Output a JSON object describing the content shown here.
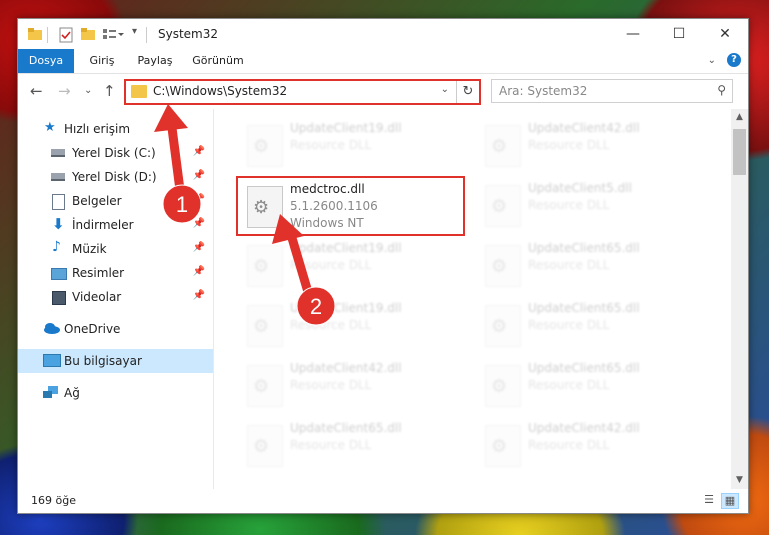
{
  "window": {
    "title": "System32"
  },
  "ribbon": {
    "tabs": [
      "Dosya",
      "Giriş",
      "Paylaş",
      "Görünüm"
    ]
  },
  "address": {
    "path": "C:\\Windows\\System32"
  },
  "search": {
    "placeholder": "Ara: System32"
  },
  "nav": {
    "items": [
      {
        "label": "Hızlı erişim",
        "icon": "star-icon",
        "pinned": false
      },
      {
        "label": "Yerel Disk (C:)",
        "icon": "drive-icon",
        "pinned": true
      },
      {
        "label": "Yerel Disk (D:)",
        "icon": "drive-icon",
        "pinned": true
      },
      {
        "label": "Belgeler",
        "icon": "document-icon",
        "pinned": true
      },
      {
        "label": "İndirmeler",
        "icon": "download-icon",
        "pinned": true
      },
      {
        "label": "Müzik",
        "icon": "music-icon",
        "pinned": true
      },
      {
        "label": "Resimler",
        "icon": "pictures-icon",
        "pinned": true
      },
      {
        "label": "Videolar",
        "icon": "video-icon",
        "pinned": true
      },
      {
        "label": "OneDrive",
        "icon": "cloud-icon",
        "pinned": false
      },
      {
        "label": "Bu bilgisayar",
        "icon": "computer-icon",
        "pinned": false,
        "selected": true
      },
      {
        "label": "Ağ",
        "icon": "network-icon",
        "pinned": false
      }
    ]
  },
  "files": {
    "highlighted": {
      "name": "medctroc.dll",
      "version": "5.1.2600.1106",
      "company": "Windows NT"
    },
    "col1": [
      {
        "name": "UpdateClient19.dll",
        "desc": "Resource DLL"
      },
      {
        "name": "UpdateClient19.dll",
        "desc": "Resource DLL"
      },
      {
        "name": "UpdateClient19.dll",
        "desc": "Resource DLL"
      },
      {
        "name": "UpdateClient42.dll",
        "desc": "Resource DLL"
      },
      {
        "name": "UpdateClient65.dll",
        "desc": "Resource DLL"
      }
    ],
    "col2": [
      {
        "name": "UpdateClient42.dll",
        "desc": "Resource DLL"
      },
      {
        "name": "UpdateClient5.dll",
        "desc": "Resource DLL"
      },
      {
        "name": "UpdateClient65.dll",
        "desc": "Resource DLL"
      },
      {
        "name": "UpdateClient65.dll",
        "desc": "Resource DLL"
      },
      {
        "name": "UpdateClient65.dll",
        "desc": "Resource DLL"
      },
      {
        "name": "UpdateClient42.dll",
        "desc": "Resource DLL"
      }
    ]
  },
  "status": {
    "item_count": "169 öğe"
  },
  "annotations": {
    "step1": "1",
    "step2": "2"
  },
  "colors": {
    "accent": "#1979ca",
    "highlight": "#e0312b",
    "selected": "#cce8ff"
  }
}
